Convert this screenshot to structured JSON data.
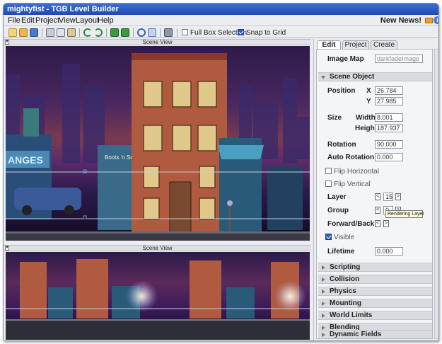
{
  "window": {
    "title": "mightyfist - TGB Level Builder"
  },
  "menu": [
    "File",
    "Edit",
    "Project",
    "View",
    "Layout",
    "Help"
  ],
  "news": {
    "label": "New News!",
    "mail_icon": "mail-icon",
    "info_icon": "info-icon"
  },
  "toolbar": {
    "icons": [
      "new-file-icon",
      "open-folder-icon",
      "save-icon",
      "cut-icon",
      "copy-icon",
      "paste-icon",
      "undo-icon",
      "redo-icon",
      "layer-icon",
      "layer-add-icon",
      "rotate-icon",
      "select-icon",
      "camera-icon"
    ],
    "full_box_selection": {
      "label": "Full Box Selection",
      "checked": false
    },
    "snap_to_grid": {
      "label": "Snap to Grid",
      "checked": true
    }
  },
  "views": {
    "scene_view_top": "Scene View",
    "scene_view_bottom": "Scene View"
  },
  "scene": {
    "shop_sign_left": "ANGES",
    "shop_sign_center": "Boots 'n Snuff"
  },
  "panel": {
    "tabs": [
      "Edit",
      "Project",
      "Create"
    ],
    "selected_tab": "Edit",
    "image_map": {
      "label": "Image Map",
      "value": "darkfadeImage"
    },
    "scene_object": {
      "title": "Scene Object",
      "position": {
        "label": "Position",
        "x_label": "X",
        "x": "26.784",
        "y_label": "Y",
        "y": "27.985"
      },
      "size": {
        "label": "Size",
        "width_label": "Width",
        "width": "8.001",
        "height_label": "Height",
        "height": "187.937"
      },
      "rotation": {
        "label": "Rotation",
        "value": "90.000"
      },
      "auto_rotation": {
        "label": "Auto Rotation",
        "value": "0.000"
      },
      "flip_horizontal": {
        "label": "Flip Horizontal",
        "checked": false
      },
      "flip_vertical": {
        "label": "Flip Vertical",
        "checked": false
      },
      "layer": {
        "label": "Layer",
        "value": "15"
      },
      "group": {
        "label": "Group",
        "value": "0"
      },
      "forward_back": {
        "label": "Forward/Back"
      },
      "visible": {
        "label": "Visible",
        "checked": true
      },
      "lifetime": {
        "label": "Lifetime",
        "value": "0.000"
      }
    },
    "tooltip": "Rendering Layer",
    "sections": [
      "Scripting",
      "Collision",
      "Physics",
      "Mounting",
      "World Limits",
      "Blending",
      "Dynamic Fields"
    ]
  }
}
